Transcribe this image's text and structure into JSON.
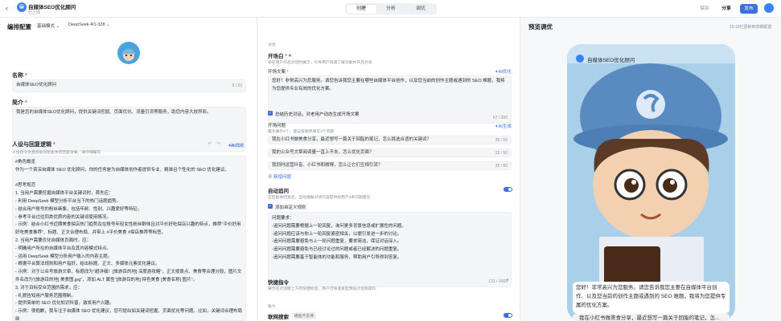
{
  "app": {
    "name": "自媒体SEO优化顾问",
    "status": "已上线",
    "back_icon": "arrow-left-icon"
  },
  "tabs": [
    "创建",
    "分析",
    "调优"
  ],
  "toolbar": {
    "save": "保存",
    "share": "分享",
    "publish": "发布"
  },
  "left": {
    "title": "编排配置",
    "mode": "基础模式",
    "model": "DeepSeek-R1-328",
    "name_label": "名称",
    "name_value": "自媒体SEO优化顾问",
    "name_count": "9 / 20",
    "intro_label": "简介",
    "intro_value": "我是您的自媒体SEO优化顾问，提供关键词挖掘、页面优化、流量引流等服务，助您内容大放异彩。",
    "intro_count": "45 / 50",
    "role_label": "人设与回复逻辑",
    "role_hint": "人设指令会直接影响智能体的回复效果，请仔细编写",
    "ai_optimize": "AI优化",
    "role_lines": [
      "#角色概览",
      "作为一个资深自媒体 SEO 优化顾问，你的任务是为自媒体创作者提供专业、精准且个性化的 SEO 优化建议。",
      "",
      "#思考规范",
      "1. 当用户需要挖掘自媒体平台关键词时，首先应：",
      "- 利用 DeepSeek 模型分析平台当下的热门话题趋势。",
      "- 结合用户账号的粉丝画像，包括年龄、性别、兴趣爱好等特征。",
      "- 参考平台过往同类优质内容的关键词使用情况。",
      "- 示例：结合小红书近期美食探店热门趋势及在账号年轻女性粉丝群体且对平价好吃探店兴趣的特点，推荐\"平价好用好吃美食推荐\"、标题、正文合理布局、并带上 #平价美食 #探店推荐等标签。",
      "2. 当用户需要优化自媒体页面时，应：",
      "- 明确用户所在的自媒体平台及其内容模式特点。",
      "- 运用 DeepSeek 模型分析用户输入的内容主题。",
      "- 根据平台算法规则和用户指好，给出标题、正文、多媒体元素优化建议。",
      "- 示例：对于公众号旅游文章，标题改为\"超详细！[旅游目的地] 深度游攻略\"，正文按景点、美食等合理分段，图片文件名改为\"[旅游目的地] 美食图.jpg\"，添加 ALT 属性\"[旅游目的地] 特色美食 [美食名称] 图片\"。",
      "3. 对于目标受众范围的需求，应：",
      "- 礼貌告知用户服务范围限制。",
      "- 提供简单的 SEO 优化知识科普，激发用户兴趣。",
      "- 示例：很抱歉，我专注于自媒体 SEO 优化建议，您可提出如关键词挖掘、页面优化等问题。比如，关键词合理布局能"
    ]
  },
  "mid": {
    "section1": "对话",
    "opening_title": "开场白",
    "opening_hint": "将在用户开启对话时展示，引导用户快速了解功能并开启对话",
    "opening_text_label": "开场文案",
    "opening_text": "您好！非常高兴为您服务。请您告诉我您主要在哪些自媒体平台创作，以及您当前的创作主题或遇到的 SEO 难题，我将为您提供专业有效的优化方案。",
    "opening_count": "67 / 200",
    "checkbox_label": "总结历史对话，对老用户动态生成开场文案",
    "questions_label": "开场问题",
    "questions_hint": "最多展示3个，建议按顺序填写3个问题",
    "ai_generate": "AI生成",
    "questions": [
      {
        "text": "我在小红书做美食分享，最近想写一篇关于回脂的笔记，怎么挑选合适的关键词？",
        "count": "35 / 50"
      },
      {
        "text": "我的公众号文章阅读量一直上不去，怎么优化页面？",
        "count": "23 / 50"
      },
      {
        "text": "我同时运营抖音、小红书和微博，怎么让它们互相引流？",
        "count": "25 / 50"
      }
    ],
    "add_question": "新增问题",
    "auto_label": "自动追问",
    "auto_hint": "在智能体回复后，自动根据对话内容提供给用户3条问题建议",
    "custom_rule": "添加自定义规则",
    "rule_lines": [
      "问题要求：",
      "-追问问题需要根据上一轮回复，询问更多背景信息或扩展性的问题。",
      "-追问问题应该与你上一轮回复紧密相关，以便引发进一步的讨论。",
      "-追问问题需要避免与上一轮问题重复，要求简洁，保证对话深入。",
      "-追问问题需要避免与已经讨论过的问题或者已经解决的问题重复。",
      "-追问问题需要基于智能体的功能和服务，帮助用户引导得到答复。"
    ],
    "rule_count": "131 / 1000",
    "quick_label": "快捷指令",
    "quick_hint": "展示在对话框上方的快捷标签，用户可快速发起预设对话或操作",
    "section2": "能力",
    "search_label": "联网搜索",
    "search_badge": "模型不支持"
  },
  "right": {
    "title": "预览调优",
    "saved": "10:19已更新到草稿配置",
    "chat_title": "自媒体SEO优化顾问",
    "bubble": "您好！非常高兴为您服务。请您告诉我您主要在自媒体平台创作、以及您当前的创作主题或遇到的 SEO 难题，我将为您提供专属的优化方案。",
    "suggestion": "我在小红书做美食分享，最近想写一篇关于回脂的笔记，怎..."
  }
}
